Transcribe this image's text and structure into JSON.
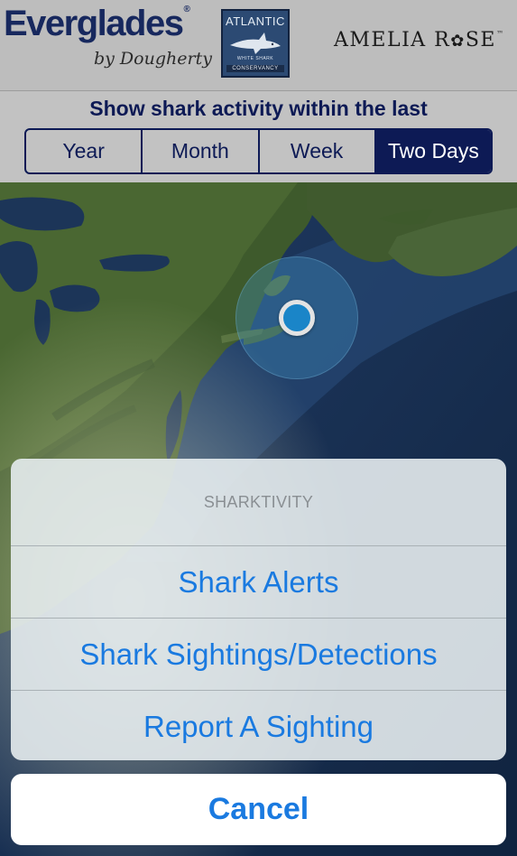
{
  "sponsors": {
    "everglades": {
      "name": "Everglades",
      "reg_mark": "®",
      "subtitle": "by Dougherty"
    },
    "awsc": {
      "top": "ATLANTIC",
      "small": "WHITE SHARK",
      "bottom": "CONSERVANCY",
      "icon": "shark-icon"
    },
    "amelia_rose": {
      "part1": "AMELIA R",
      "rose": "✿",
      "part2": "SE",
      "tm": "™"
    }
  },
  "filter": {
    "title": "Show shark activity within the last",
    "options": [
      "Year",
      "Month",
      "Week",
      "Two Days"
    ],
    "selected": "Two Days"
  },
  "map": {
    "marker_icon": "location-dot-icon",
    "marker_color": "#1a85c8"
  },
  "action_sheet": {
    "title": "SHARKTIVITY",
    "options": [
      "Shark Alerts",
      "Shark Sightings/Detections",
      "Report A Sighting"
    ],
    "cancel": "Cancel"
  },
  "colors": {
    "navy": "#0d1a55",
    "ios_blue": "#1a7ae0",
    "header_bg": "#bdbdbd"
  }
}
